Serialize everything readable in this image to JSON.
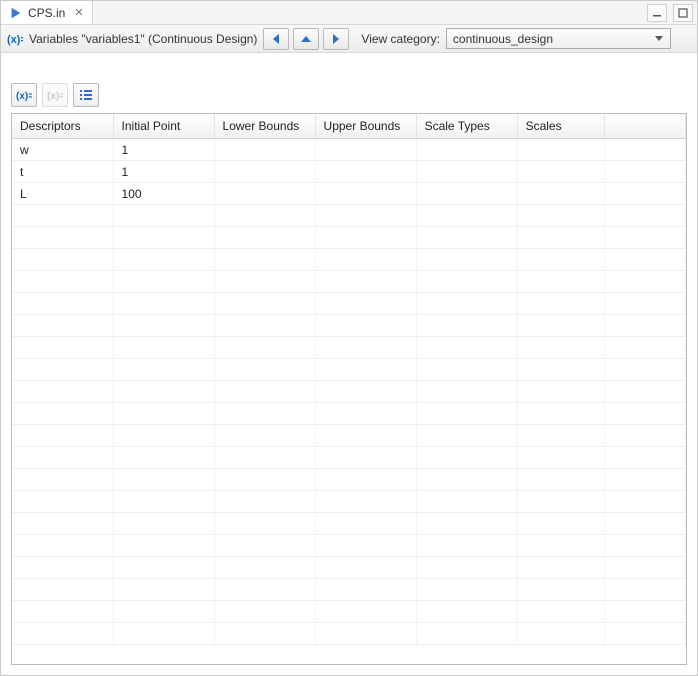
{
  "tab": {
    "title": "CPS.in"
  },
  "header": {
    "title": "Variables \"variables1\" (Continuous Design)",
    "view_category_label": "View category:",
    "view_category_value": "continuous_design"
  },
  "columns": [
    "Descriptors",
    "Initial Point",
    "Lower Bounds",
    "Upper Bounds",
    "Scale Types",
    "Scales",
    ""
  ],
  "rows": [
    {
      "descriptor": "w",
      "initial_point": "1",
      "lower": "",
      "upper": "",
      "scale_type": "",
      "scale": ""
    },
    {
      "descriptor": "t",
      "initial_point": "1",
      "lower": "",
      "upper": "",
      "scale_type": "",
      "scale": ""
    },
    {
      "descriptor": "L",
      "initial_point": "100",
      "lower": "",
      "upper": "",
      "scale_type": "",
      "scale": ""
    }
  ],
  "empty_row_count": 20
}
